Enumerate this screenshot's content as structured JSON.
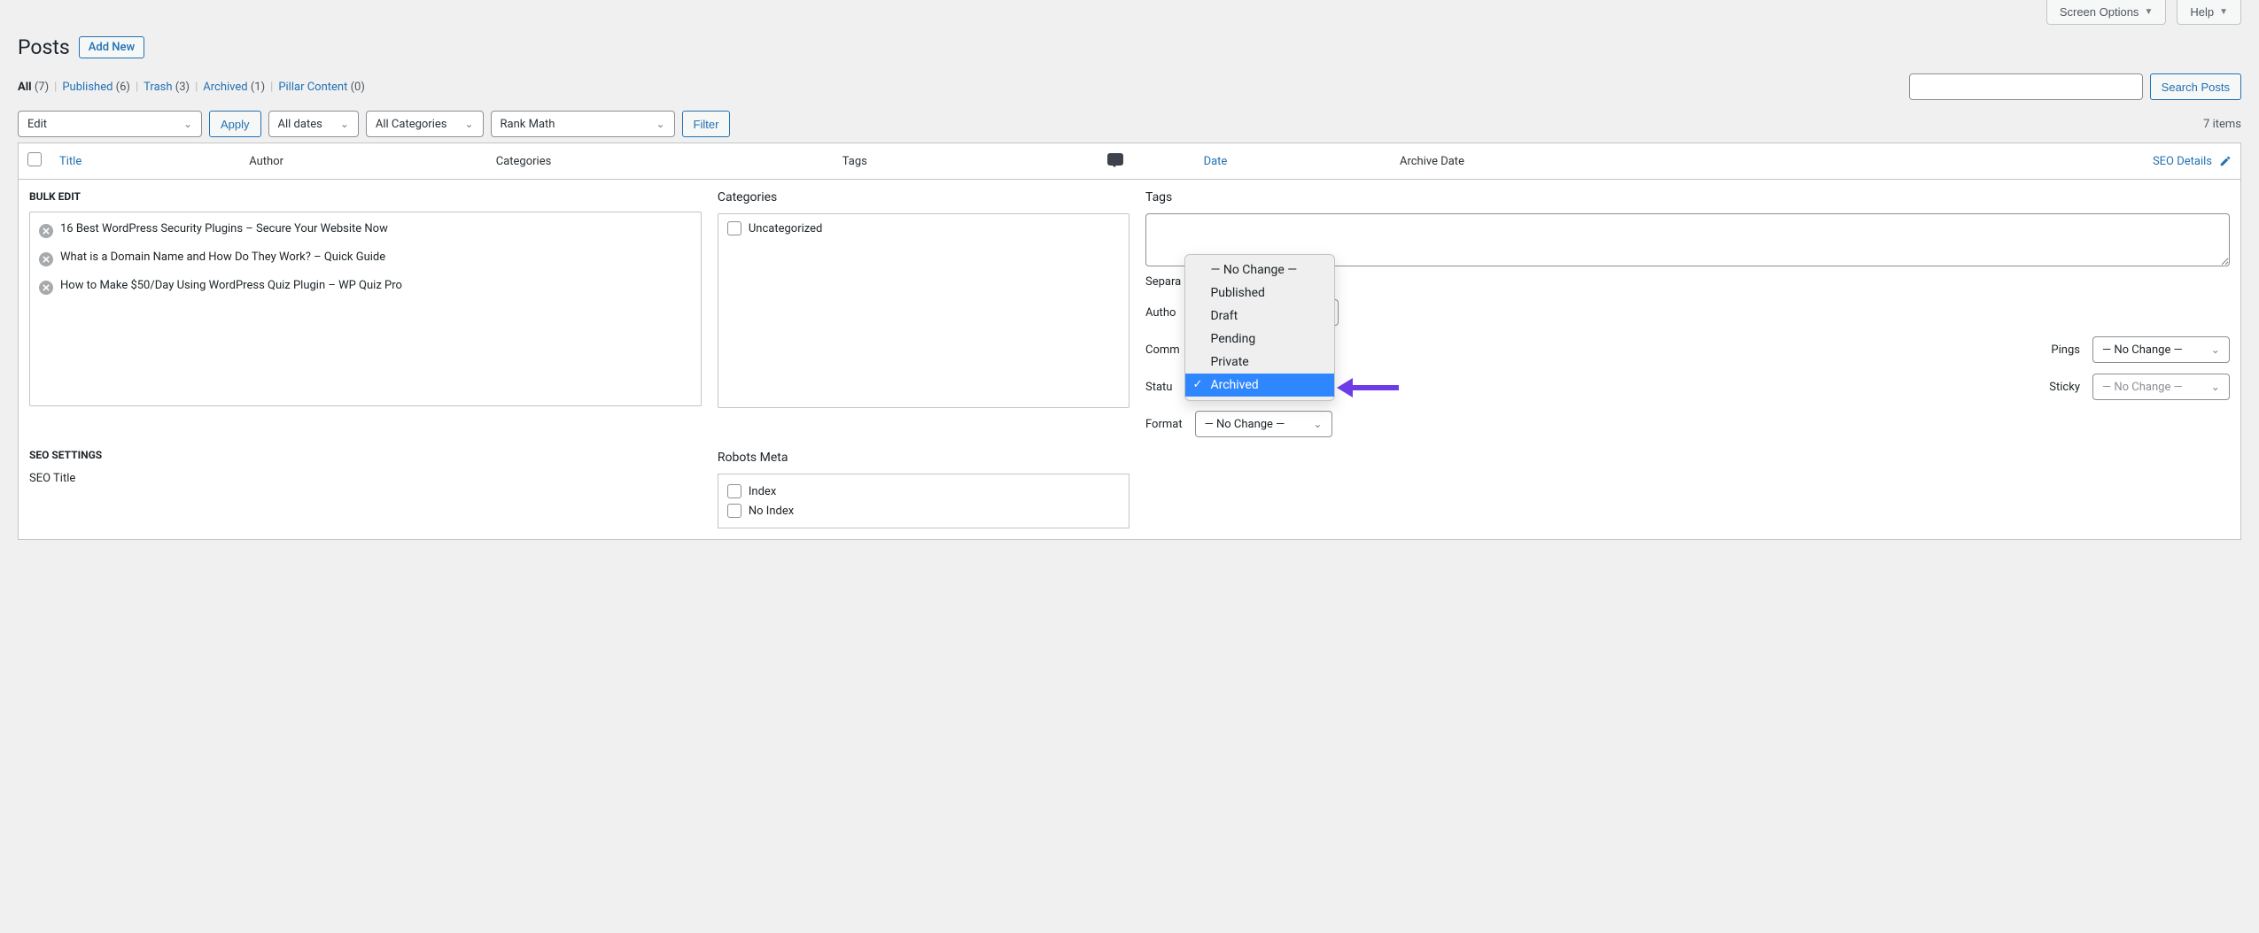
{
  "topTabs": {
    "screenOptions": "Screen Options",
    "help": "Help"
  },
  "page": {
    "title": "Posts",
    "addNew": "Add New"
  },
  "views": [
    {
      "label": "All",
      "count": "(7)",
      "current": true
    },
    {
      "label": "Published",
      "count": "(6)"
    },
    {
      "label": "Trash",
      "count": "(3)"
    },
    {
      "label": "Archived",
      "count": "(1)"
    },
    {
      "label": "Pillar Content",
      "count": "(0)"
    }
  ],
  "search": {
    "btn": "Search Posts"
  },
  "bulkAction": {
    "selected": "Edit",
    "apply": "Apply"
  },
  "filters": {
    "dates": "All dates",
    "categories": "All Categories",
    "rankMath": "Rank Math",
    "filterBtn": "Filter"
  },
  "itemsCount": "7 items",
  "columns": {
    "title": "Title",
    "author": "Author",
    "categories": "Categories",
    "tags": "Tags",
    "date": "Date",
    "archiveDate": "Archive Date",
    "seoDetails": "SEO Details"
  },
  "bulkEdit": {
    "legend": "BULK EDIT",
    "titles": [
      "16 Best WordPress Security Plugins – Secure Your Website Now",
      "What is a Domain Name and How Do They Work? – Quick Guide",
      "How to Make $50/Day Using WordPress Quiz Plugin – WP Quiz Pro"
    ],
    "categoriesLegend": "Categories",
    "categories": [
      "Uncategorized"
    ],
    "tagsLegend": "Tags",
    "tagsHint": "Separa",
    "labels": {
      "author": "Autho",
      "comments": "Comm",
      "status": "Statu",
      "format": "Format",
      "pings": "Pings",
      "sticky": "Sticky"
    },
    "noChange": "— No Change —",
    "statusOptions": [
      "— No Change —",
      "Published",
      "Draft",
      "Pending",
      "Private",
      "Archived"
    ],
    "statusSelected": "Archived"
  },
  "seo": {
    "legend": "SEO SETTINGS",
    "seoTitleLabel": "SEO Title",
    "robotsLegend": "Robots Meta",
    "robots": [
      "Index",
      "No Index"
    ]
  }
}
